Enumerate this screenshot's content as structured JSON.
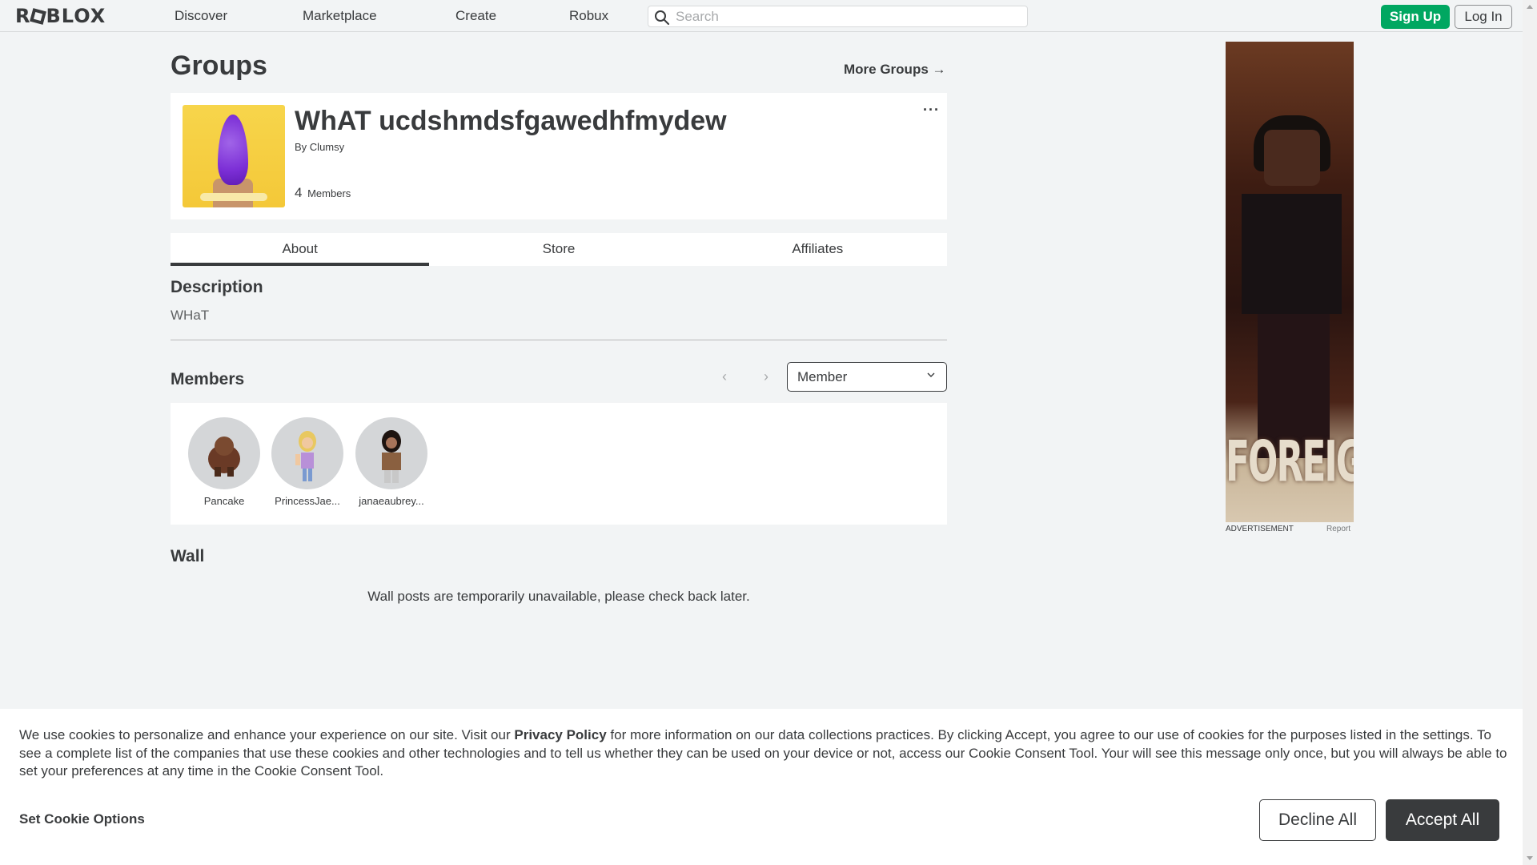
{
  "nav": {
    "logo": "ROBLOX",
    "links": [
      "Discover",
      "Marketplace",
      "Create",
      "Robux"
    ],
    "search_placeholder": "Search",
    "signup_label": "Sign Up",
    "login_label": "Log In"
  },
  "page": {
    "title": "Groups",
    "more_groups": "More Groups →"
  },
  "group": {
    "name": "WhAT ucdshmdsfgawedhfmydew",
    "by_prefix": "By",
    "owner": "Clumsy",
    "member_count": "4",
    "member_label": "Members"
  },
  "tabs": [
    {
      "label": "About",
      "active": true
    },
    {
      "label": "Store",
      "active": false
    },
    {
      "label": "Affiliates",
      "active": false
    }
  ],
  "description": {
    "title": "Description",
    "text": "WHaT"
  },
  "members": {
    "title": "Members",
    "role_selected": "Member",
    "list": [
      {
        "name": "Pancake"
      },
      {
        "name": "PrincessJae..."
      },
      {
        "name": "janaeaubrey..."
      }
    ]
  },
  "wall": {
    "title": "Wall",
    "message": "Wall posts are temporarily unavailable, please check back later."
  },
  "ad": {
    "label": "ADVERTISEMENT",
    "report": "Report",
    "image_text": "FOREIGN"
  },
  "cookie": {
    "text_before": "We use cookies to personalize and enhance your experience on our site. Visit our ",
    "policy_link": "Privacy Policy",
    "text_after": " for more information on our data collections practices. By clicking Accept, you agree to our use of cookies for the purposes listed in the settings. To see a complete list of the companies that use these cookies and other technologies and to tell us whether they can be used on your device or not, access our Cookie Consent Tool. Your will see this message only once, but you will always be able to set your preferences at any time in the Cookie Consent Tool.",
    "options_label": "Set Cookie Options",
    "decline_label": "Decline All",
    "accept_label": "Accept All"
  },
  "colors": {
    "background": "#f2f4f5",
    "text": "#393b3d",
    "signup_green": "#00a761",
    "card": "#ffffff"
  }
}
